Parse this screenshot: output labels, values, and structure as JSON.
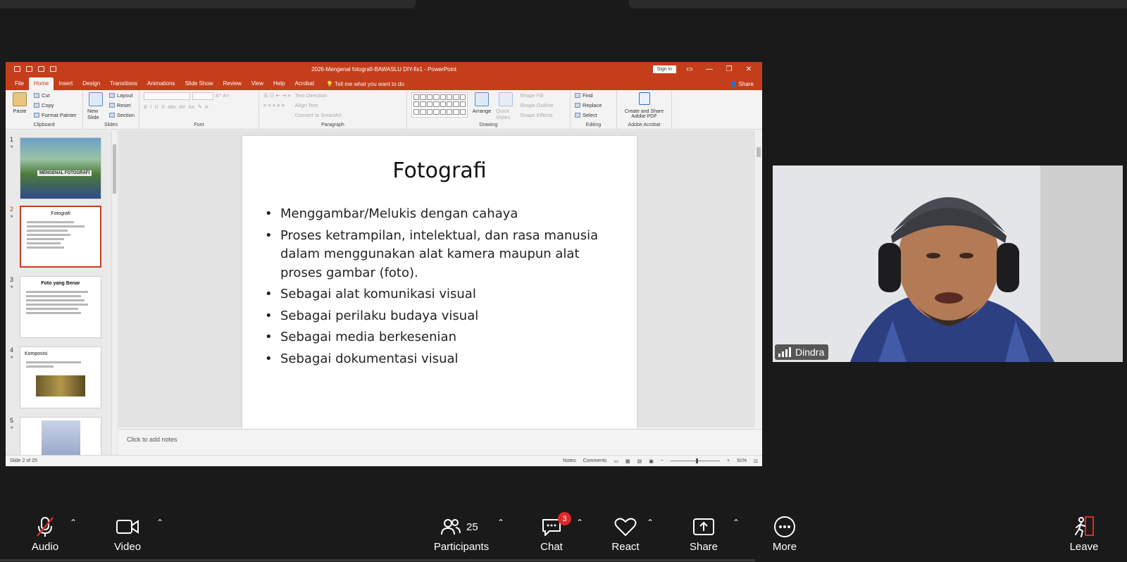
{
  "powerpoint": {
    "title": "2026-Mengenal fotografi-BAWASLU DIY-fix1  -  PowerPoint",
    "sign_in": "Sign in",
    "tabs": [
      "File",
      "Home",
      "Insert",
      "Design",
      "Transitions",
      "Animations",
      "Slide Show",
      "Review",
      "View",
      "Help",
      "Acrobat"
    ],
    "tell_me": "Tell me what you want to do",
    "share": "Share",
    "ribbon": {
      "clipboard": {
        "label": "Clipboard",
        "paste": "Paste",
        "cut": "Cut",
        "copy": "Copy",
        "format_painter": "Format Painter"
      },
      "slides": {
        "label": "Slides",
        "new_slide": "New Slide",
        "layout": "Layout",
        "reset": "Reset",
        "section": "Section"
      },
      "font": {
        "label": "Font"
      },
      "paragraph": {
        "label": "Paragraph",
        "text_direction": "Text Direction",
        "align_text": "Align Text",
        "convert": "Convert to SmartArt"
      },
      "drawing": {
        "label": "Drawing",
        "arrange": "Arrange",
        "quick_styles": "Quick Styles",
        "shape_fill": "Shape Fill",
        "shape_outline": "Shape Outline",
        "shape_effects": "Shape Effects"
      },
      "editing": {
        "label": "Editing",
        "find": "Find",
        "replace": "Replace",
        "select": "Select"
      },
      "acrobat": {
        "label": "Adobe Acrobat",
        "create": "Create and Share Adobe PDF"
      }
    },
    "thumbnails": [
      {
        "num": "1",
        "caption": "MENGENAL FOTOGRAFI"
      },
      {
        "num": "2",
        "title": "Fotografi"
      },
      {
        "num": "3",
        "title": "Foto yang Benar"
      },
      {
        "num": "4",
        "title": "Komposisi"
      },
      {
        "num": "5"
      }
    ],
    "slide": {
      "title": "Fotografi",
      "bullets": [
        "Menggambar/Melukis dengan cahaya",
        "Proses ketrampilan, intelektual, dan rasa manusia dalam menggunakan alat kamera maupun alat proses gambar (foto).",
        "Sebagai alat komunikasi visual",
        "Sebagai perilaku budaya visual",
        "Sebagai media berkesenian",
        "Sebagai dokumentasi visual"
      ]
    },
    "notes_placeholder": "Click to add notes",
    "status": {
      "slide_count": "Slide 2 of 25",
      "notes": "Notes",
      "comments": "Comments",
      "zoom": "91%"
    }
  },
  "video": {
    "name": "Dindra"
  },
  "toolbar": {
    "audio": "Audio",
    "video": "Video",
    "participants": "Participants",
    "participants_count": "25",
    "chat": "Chat",
    "chat_badge": "3",
    "react": "React",
    "share": "Share",
    "more": "More",
    "leave": "Leave"
  },
  "colors": {
    "ppt_accent": "#c43e1c",
    "toolbar_bg": "#1a1a1a",
    "badge": "#e02828"
  }
}
